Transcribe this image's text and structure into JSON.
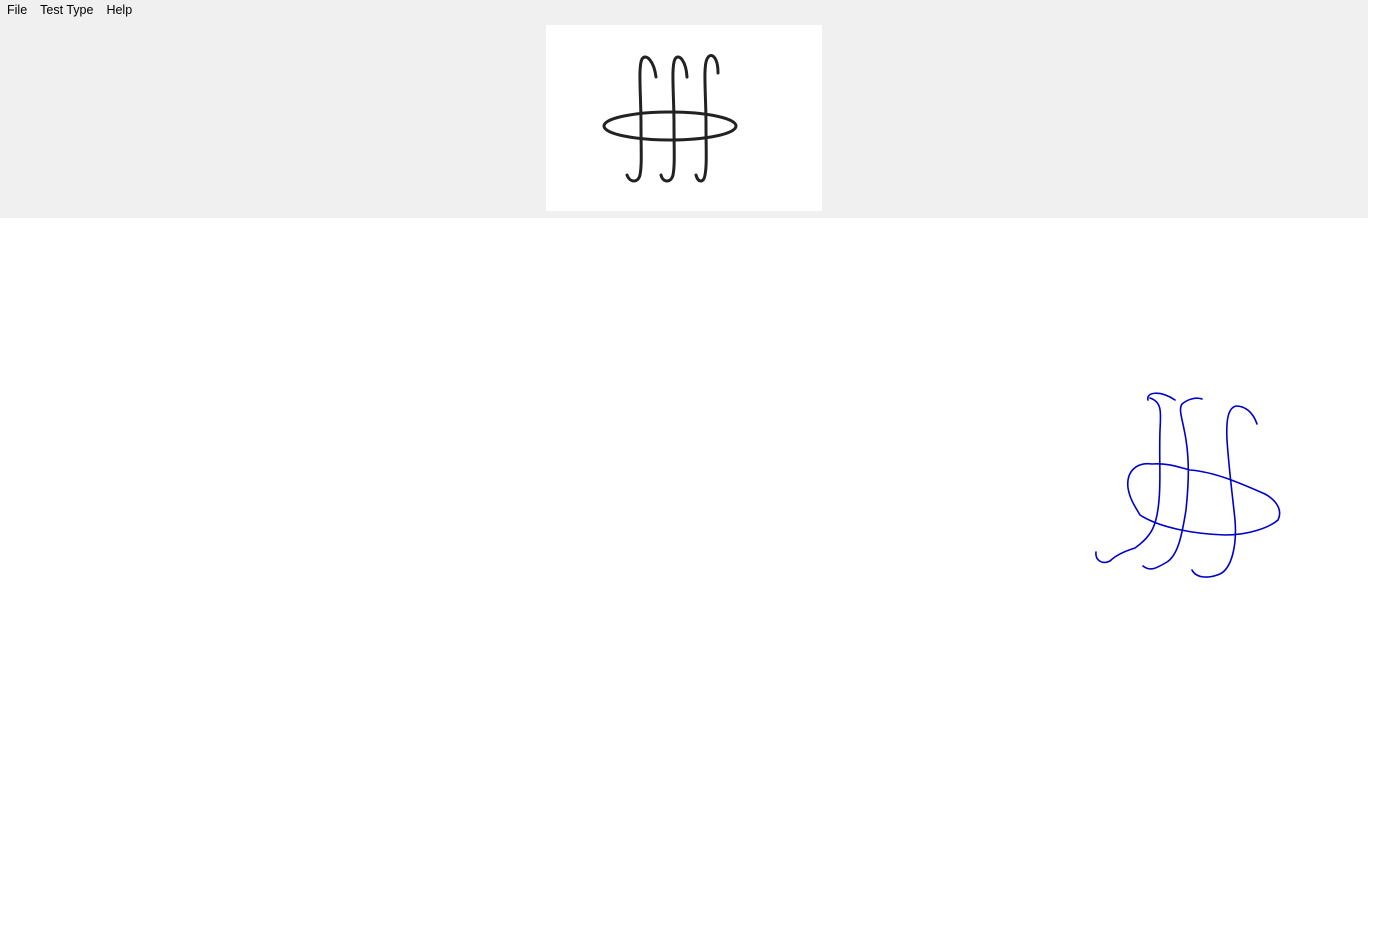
{
  "menu": {
    "items": [
      {
        "label": "File"
      },
      {
        "label": "Test Type"
      },
      {
        "label": "Help"
      }
    ]
  },
  "reference_figure": {
    "name": "reference-glyph",
    "stroke_color": "#222222"
  },
  "user_drawing": {
    "name": "user-drawing",
    "stroke_color": "#0000cc"
  },
  "colors": {
    "panel_bg": "#f0f0f0",
    "canvas_bg": "#ffffff"
  }
}
